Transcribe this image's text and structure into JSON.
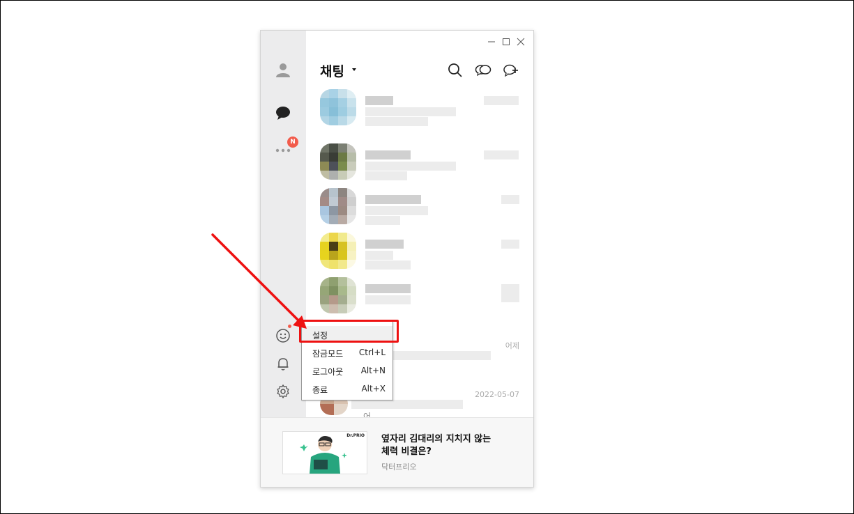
{
  "chat_header": {
    "title": "채팅"
  },
  "sidebar": {
    "more_badge": "N"
  },
  "chats": [
    {
      "time": ""
    },
    {
      "time": ""
    },
    {
      "time": ""
    },
    {
      "time": ""
    },
    {
      "time": ""
    },
    {
      "time": "어제"
    },
    {
      "time": "2022-05-07",
      "preview_tail": "어"
    }
  ],
  "context_menu": {
    "items": [
      {
        "label": "설정",
        "shortcut": ""
      },
      {
        "label": "잠금모드",
        "shortcut": "Ctrl+L"
      },
      {
        "label": "로그아웃",
        "shortcut": "Alt+N"
      },
      {
        "label": "종료",
        "shortcut": "Alt+X"
      }
    ]
  },
  "ad": {
    "title": "옆자리 김대리의  지치지 않는\n체력 비결은?",
    "sponsor": "닥터프리오",
    "image_brand": "Dr.PRIO"
  },
  "colors": {
    "accent_red": "#ee1111",
    "badge": "#f25b4b",
    "sidebar_bg": "#ececed"
  }
}
